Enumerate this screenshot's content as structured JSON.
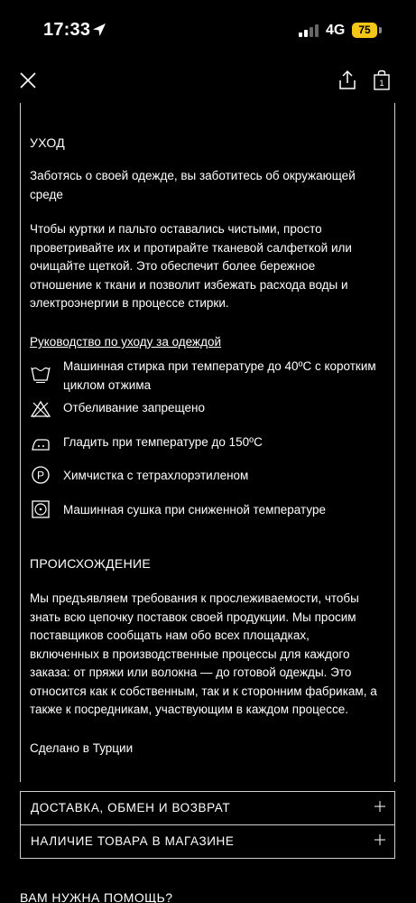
{
  "status_bar": {
    "time": "17:33",
    "network": "4G",
    "battery": "75"
  },
  "care": {
    "title": "УХОД",
    "intro": "Заботясь о своей одежде, вы заботитесь об окружающей среде",
    "body": "Чтобы куртки и пальто оставались чистыми, просто проветривайте их и протирайте тканевой салфеткой или очищайте щеткой. Это обеспечит более бережное отношение к ткани и позволит избежать расхода воды и электроэнергии в процессе стирки.",
    "guide_link": "Руководство по уходу за одеждой",
    "instructions": [
      {
        "icon": "wash-40-icon",
        "text": "Машинная стирка при температуре до 40ºC с коротким циклом отжима"
      },
      {
        "icon": "no-bleach-icon",
        "text": "Отбеливание запрещено"
      },
      {
        "icon": "iron-150-icon",
        "text": "Гладить при температуре до 150ºC"
      },
      {
        "icon": "dry-clean-p-icon",
        "text": "Химчистка с тетрахлорэтиленом"
      },
      {
        "icon": "tumble-dry-low-icon",
        "text": "Машинная сушка при сниженной температуре"
      }
    ]
  },
  "origin": {
    "title": "ПРОИСХОЖДЕНИЕ",
    "body": "Мы предъявляем требования к прослеживаемости, чтобы знать всю цепочку поставок своей продукции. Мы просим поставщиков сообщать нам обо всех площадках, включенных в производственные процессы для каждого заказа: от пряжи или волокна — до готовой одежды. Это относится как к собственным, так и к сторонним фабрикам, а также к посредникам, участвующим в каждом процессе.",
    "made_in": "Сделано в Турции"
  },
  "accordion": [
    {
      "label": "ДОСТАВКА, ОБМЕН И ВОЗВРАТ"
    },
    {
      "label": "НАЛИЧИЕ ТОВАРА В МАГАЗИНЕ"
    }
  ],
  "help": {
    "title": "ВАМ НУЖНА ПОМОЩЬ?"
  }
}
